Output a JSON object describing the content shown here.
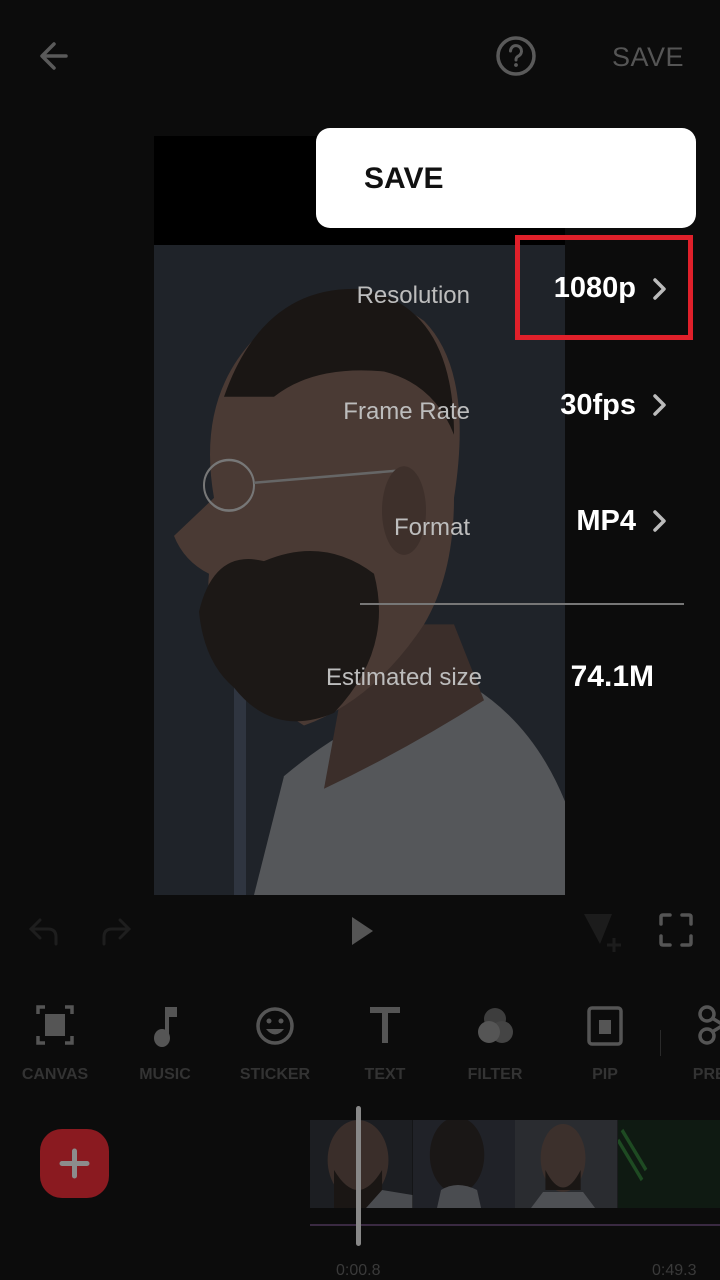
{
  "topbar": {
    "back_icon": "arrow-left-icon",
    "help_icon": "help-circle-icon",
    "save_label": "SAVE"
  },
  "save_dialog": {
    "title": "SAVE",
    "options": [
      {
        "label": "Resolution",
        "value": "1080p",
        "highlighted": true
      },
      {
        "label": "Frame Rate",
        "value": "30fps",
        "highlighted": false
      },
      {
        "label": "Format",
        "value": "MP4",
        "highlighted": false
      }
    ],
    "estimated_size_label": "Estimated size",
    "estimated_size_value": "74.1M",
    "highlight_color": "#e0202a"
  },
  "playback": {
    "undo_icon": "undo-icon",
    "redo_icon": "redo-icon",
    "play_icon": "play-icon",
    "keyframe_icon": "keyframe-add-icon",
    "fullscreen_icon": "fullscreen-icon"
  },
  "toolbar": {
    "items": [
      {
        "label": "CANVAS",
        "icon": "canvas-icon"
      },
      {
        "label": "MUSIC",
        "icon": "music-note-icon"
      },
      {
        "label": "STICKER",
        "icon": "smiley-icon"
      },
      {
        "label": "TEXT",
        "icon": "text-icon"
      },
      {
        "label": "FILTER",
        "icon": "filter-icon"
      },
      {
        "label": "PIP",
        "icon": "pip-icon"
      },
      {
        "label": "PREC",
        "icon": "scissors-icon"
      }
    ]
  },
  "timeline": {
    "add_icon": "plus-icon",
    "current_time": "0:00.8",
    "total_time": "0:49.3",
    "accent_color": "#8a1a20"
  }
}
